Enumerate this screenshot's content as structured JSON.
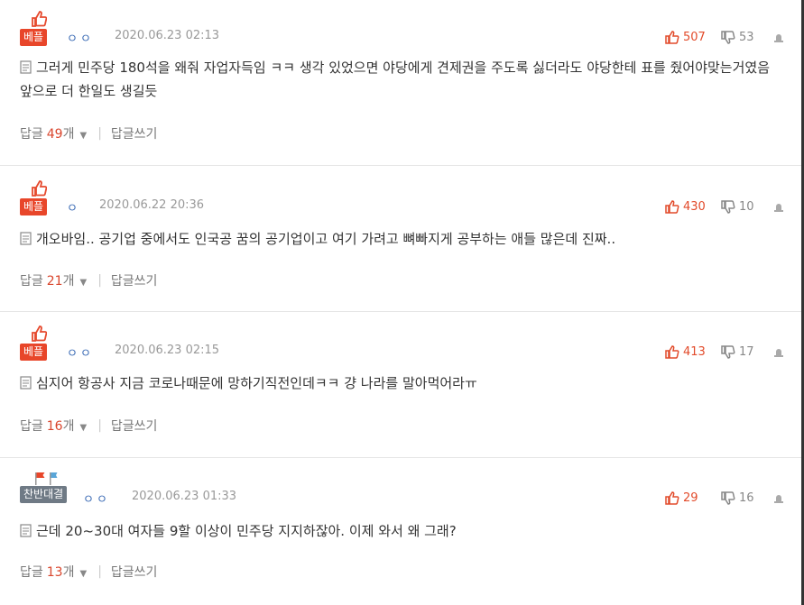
{
  "comments": [
    {
      "badge": "베플",
      "nickname": "ㅇㅇ",
      "date": "2020.06.23 02:13",
      "upvotes": "507",
      "downvotes": "53",
      "text": "그러게 민주당 180석을 왜줘 자업자득임 ㅋㅋ 생각 있었으면 야당에게 견제권을 주도록 싫더라도 야당한테 표를 줬어야맞는거였음 앞으로 더 한일도 생길듯",
      "reply_label": "답글",
      "reply_count": "49",
      "reply_unit": "개",
      "write_label": "답글쓰기"
    },
    {
      "badge": "베플",
      "nickname": "ㅇ",
      "date": "2020.06.22 20:36",
      "upvotes": "430",
      "downvotes": "10",
      "text": "개오바임.. 공기업 중에서도 인국공 꿈의 공기업이고 여기 가려고 뼈빠지게 공부하는 애들 많은데 진짜..",
      "reply_label": "답글",
      "reply_count": "21",
      "reply_unit": "개",
      "write_label": "답글쓰기"
    },
    {
      "badge": "베플",
      "nickname": "ㅇㅇ",
      "date": "2020.06.23 02:15",
      "upvotes": "413",
      "downvotes": "17",
      "text": "심지어 항공사 지금 코로나때문에 망하기직전인데ㅋㅋ 걍 나라를 말아먹어라ㅠ",
      "reply_label": "답글",
      "reply_count": "16",
      "reply_unit": "개",
      "write_label": "답글쓰기"
    },
    {
      "badge": "찬반대결",
      "nickname": "ㅇㅇ",
      "date": "2020.06.23 01:33",
      "upvotes": "29",
      "downvotes": "16",
      "text": "근데 20~30대 여자들 9할 이상이 민주당 지지하잖아. 이제 와서 왜 그래?",
      "reply_label": "답글",
      "reply_count": "13",
      "reply_unit": "개",
      "write_label": "답글쓰기"
    }
  ],
  "colors": {
    "accent_red": "#e8462a",
    "badge_gray": "#6f7a85",
    "nickname_blue": "#3b6bb5"
  },
  "icons": {
    "best": "thumbs-up-icon",
    "vs": "flags-icon",
    "upvote": "thumb-up-icon",
    "downvote": "thumb-down-icon",
    "report": "siren-icon",
    "text": "document-icon",
    "expand": "chevron-down-icon"
  }
}
